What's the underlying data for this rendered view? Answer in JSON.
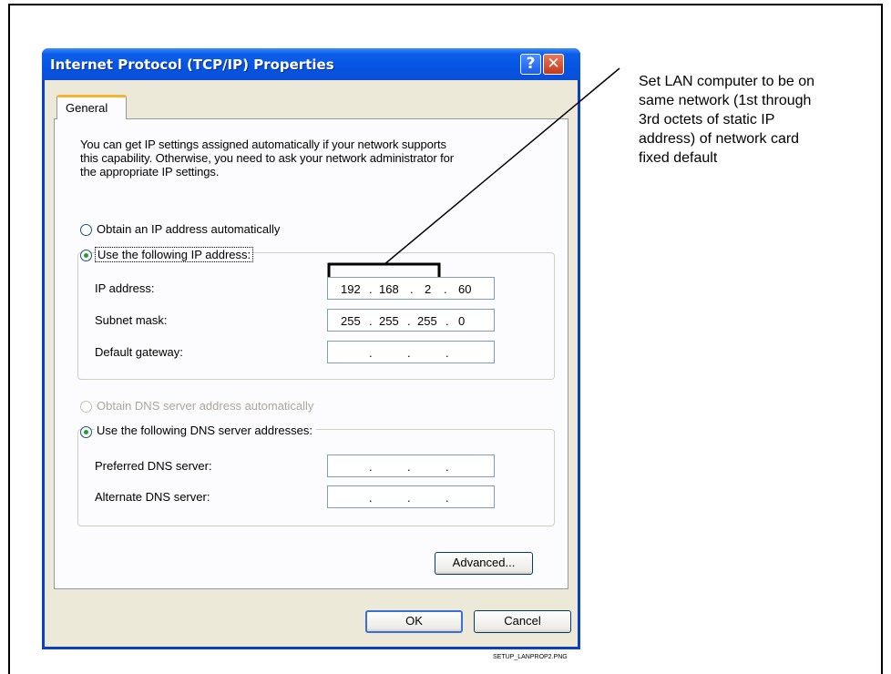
{
  "dialog": {
    "title": "Internet Protocol (TCP/IP) Properties",
    "help_glyph": "?",
    "close_glyph": "✕",
    "tab_label": "General",
    "intro_line1": "You can get IP settings assigned automatically if your network supports",
    "intro_line2": "this capability. Otherwise, you need to ask your network administrator for",
    "intro_line3": "the appropriate IP settings.",
    "ip_auto_label": "Obtain an IP address automatically",
    "ip_manual_label": "Use the following IP address:",
    "ip_address_label": "IP address:",
    "ip_address": [
      "192",
      "168",
      "2",
      "60"
    ],
    "subnet_label": "Subnet mask:",
    "subnet": [
      "255",
      "255",
      "255",
      "0"
    ],
    "gateway_label": "Default gateway:",
    "gateway": [
      "",
      "",
      "",
      ""
    ],
    "dns_auto_label": "Obtain DNS server address automatically",
    "dns_manual_label": "Use the following DNS server addresses:",
    "dns_pref_label": "Preferred DNS server:",
    "dns_alt_label": "Alternate DNS server:",
    "advanced_label": "Advanced...",
    "ok_label": "OK",
    "cancel_label": "Cancel"
  },
  "annotation": "Set LAN computer to be on\nsame network (1st through\n3rd octets of static IP\naddress) of network card\nfixed default",
  "caption": "SETUP_LANPROP2.PNG",
  "colors": {
    "titlebar": "#0554e3",
    "radio_dot": "#21a121",
    "tab_highlight": "#f3b530"
  },
  "icons": [
    "help-icon",
    "close-icon"
  ]
}
